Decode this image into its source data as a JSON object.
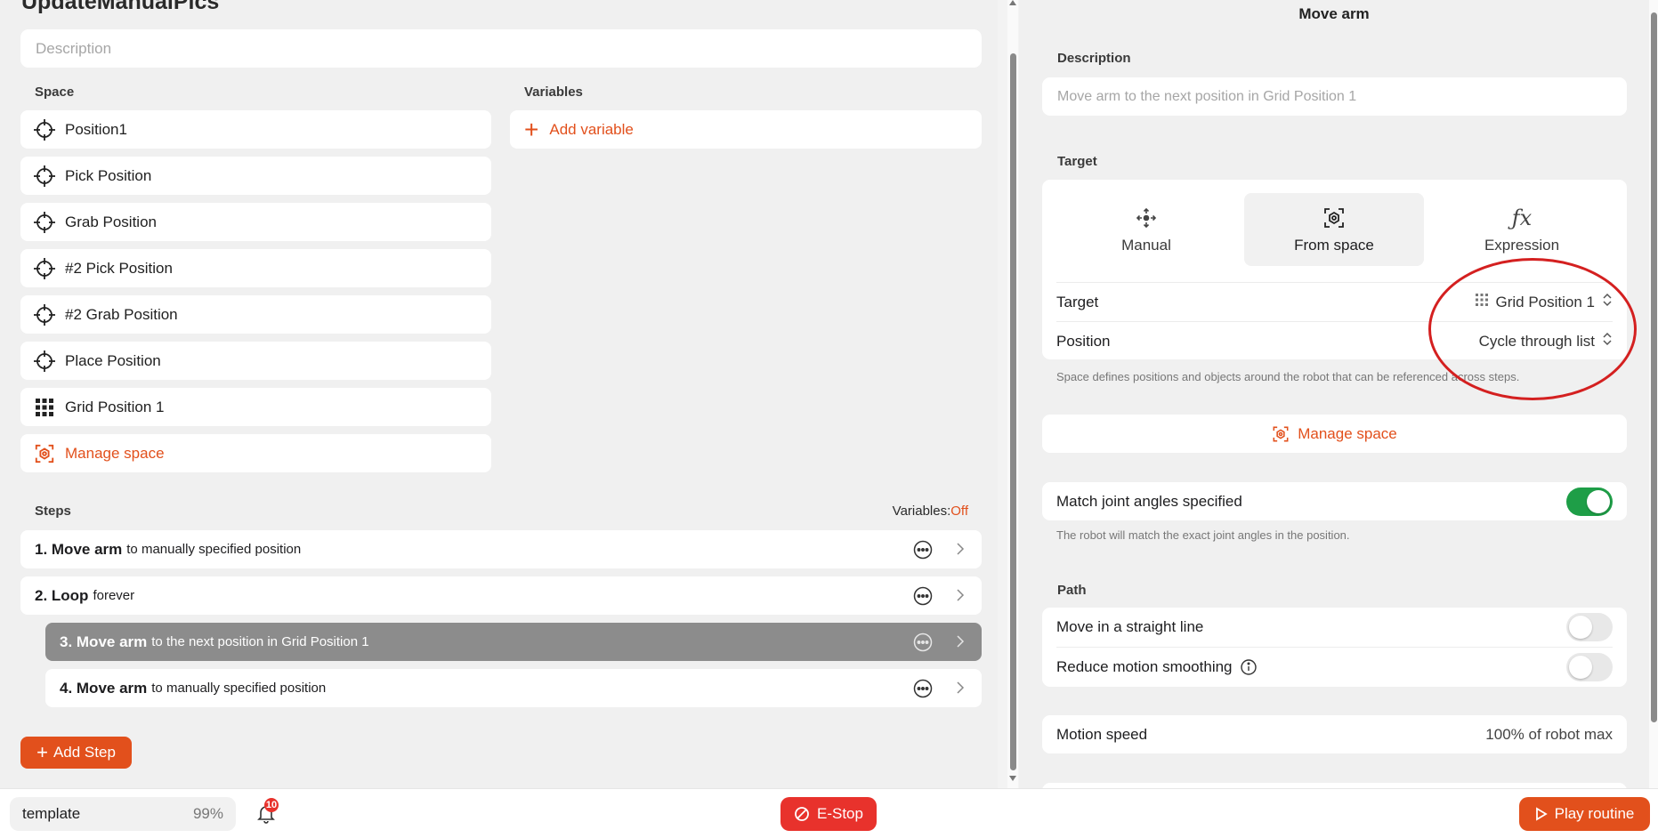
{
  "routine": {
    "title": "UpdateManualPics",
    "description_placeholder": "Description"
  },
  "space": {
    "label": "Space",
    "items": [
      {
        "label": "Position1",
        "icon": "crosshair-icon"
      },
      {
        "label": "Pick Position",
        "icon": "crosshair-icon"
      },
      {
        "label": "Grab Position",
        "icon": "crosshair-icon"
      },
      {
        "label": "#2 Pick Position",
        "icon": "crosshair-icon"
      },
      {
        "label": "#2 Grab Position",
        "icon": "crosshair-icon"
      },
      {
        "label": "Place Position",
        "icon": "crosshair-icon"
      },
      {
        "label": "Grid Position 1",
        "icon": "grid-icon"
      }
    ],
    "manage_label": "Manage space"
  },
  "variables": {
    "label": "Variables",
    "add_label": "Add variable"
  },
  "steps": {
    "label": "Steps",
    "variables_label": "Variables:",
    "variables_value": "Off",
    "items": [
      {
        "num": "1. Move arm",
        "detail": "to manually specified position",
        "selected": false
      },
      {
        "num": "2. Loop",
        "detail": "forever",
        "selected": false
      },
      {
        "num": "3. Move arm",
        "detail": "to the next position in Grid Position 1",
        "selected": true
      },
      {
        "num": "4. Move arm",
        "detail": "to manually specified position",
        "selected": false
      }
    ],
    "add_step_label": "Add Step"
  },
  "panel": {
    "title": "Move arm",
    "description_label": "Description",
    "description_value": "Move arm to the next position in Grid Position 1",
    "target_label": "Target",
    "tabs": [
      {
        "label": "Manual",
        "icon": "move-arrows-icon",
        "active": false
      },
      {
        "label": "From space",
        "icon": "space-icon",
        "active": true
      },
      {
        "label": "Expression",
        "icon": "fx-icon",
        "active": false
      }
    ],
    "target_row": {
      "label": "Target",
      "value": "Grid Position 1"
    },
    "position_row": {
      "label": "Position",
      "value": "Cycle through list"
    },
    "space_note": "Space defines positions and objects around the robot that can be referenced across steps.",
    "manage_space_label": "Manage space",
    "match_joint": {
      "label": "Match joint angles specified",
      "on": true
    },
    "match_note": "The robot will match the exact joint angles in the position.",
    "path_label": "Path",
    "straight_line": {
      "label": "Move in a straight line",
      "on": false
    },
    "reduce_smoothing": {
      "label": "Reduce motion smoothing",
      "on": false
    },
    "motion_speed": {
      "label": "Motion speed",
      "value": "100% of robot max"
    }
  },
  "footer": {
    "robot_name": "template",
    "robot_percent": "99%",
    "notifications": "10",
    "estop_label": "E-Stop",
    "play_label": "Play routine"
  },
  "colors": {
    "accent": "#e2501c",
    "estop": "#e8322c",
    "toggle_on": "#1e9e47",
    "selected_step": "#8c8c8c",
    "annotation": "#d42020"
  }
}
